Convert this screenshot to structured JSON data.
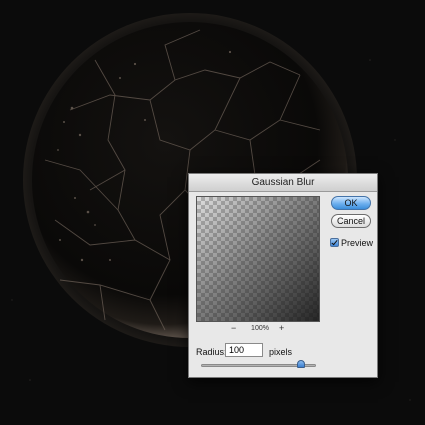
{
  "dialog": {
    "title": "Gaussian Blur",
    "ok_label": "OK",
    "cancel_label": "Cancel",
    "preview_label": "Preview",
    "preview_checked": true,
    "zoom_out_symbol": "−",
    "zoom_level": "100%",
    "zoom_in_symbol": "+",
    "radius_label": "Radius:",
    "radius_value": "100",
    "radius_units": "pixels",
    "slider_level": 0.87
  },
  "colors": {
    "ok_button": "#5ea3ea",
    "checkbox": "#5a9ee8",
    "sphere_crack": "#6a5e55"
  },
  "icons": {
    "zoom_out": "minus-icon",
    "zoom_in": "plus-icon",
    "preview_checkbox": "checkmark-icon"
  }
}
